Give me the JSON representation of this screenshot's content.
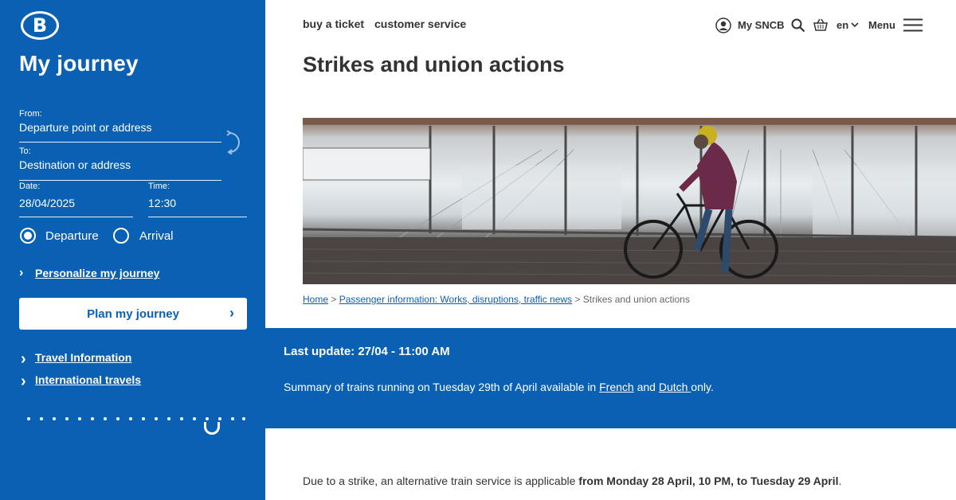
{
  "sidebar": {
    "logo_text": "B",
    "title": "My journey",
    "from_label": "From:",
    "from_placeholder": "Departure point or address",
    "to_label": "To:",
    "to_placeholder": "Destination or address",
    "date_label": "Date:",
    "date_value": "28/04/2025",
    "time_label": "Time:",
    "time_value": "12:30",
    "radio_departure": "Departure",
    "radio_arrival": "Arrival",
    "personalize_link": "Personalize my journey",
    "plan_button": "Plan my journey",
    "travel_info_link": "Travel Information",
    "international_link": "International travels"
  },
  "header": {
    "nav_buy": "buy a ticket",
    "nav_service": "customer service",
    "my_sncb": "My SNCB",
    "language": "en",
    "menu": "Menu"
  },
  "page": {
    "title": "Strikes and union actions"
  },
  "breadcrumb": {
    "home": "Home",
    "sep1": " > ",
    "passenger_info": "Passenger information: Works, disruptions, traffic news",
    "sep2": " > ",
    "current": "Strikes and union actions"
  },
  "update": {
    "title": "Last update: 27/04 - 11:00 AM",
    "text_before": "Summary of trains running on Tuesday 29th of April available in ",
    "french": "French",
    "and": " and ",
    "dutch": "Dutch ",
    "text_after": "only."
  },
  "body": {
    "text_before": "Due to a strike, an alternative train service is applicable ",
    "text_bold": "from Monday 28 April, 10 PM, to Tuesday 29 April",
    "text_after": "."
  },
  "colors": {
    "brand_blue": "#0a61b4",
    "text_dark": "#333333"
  }
}
